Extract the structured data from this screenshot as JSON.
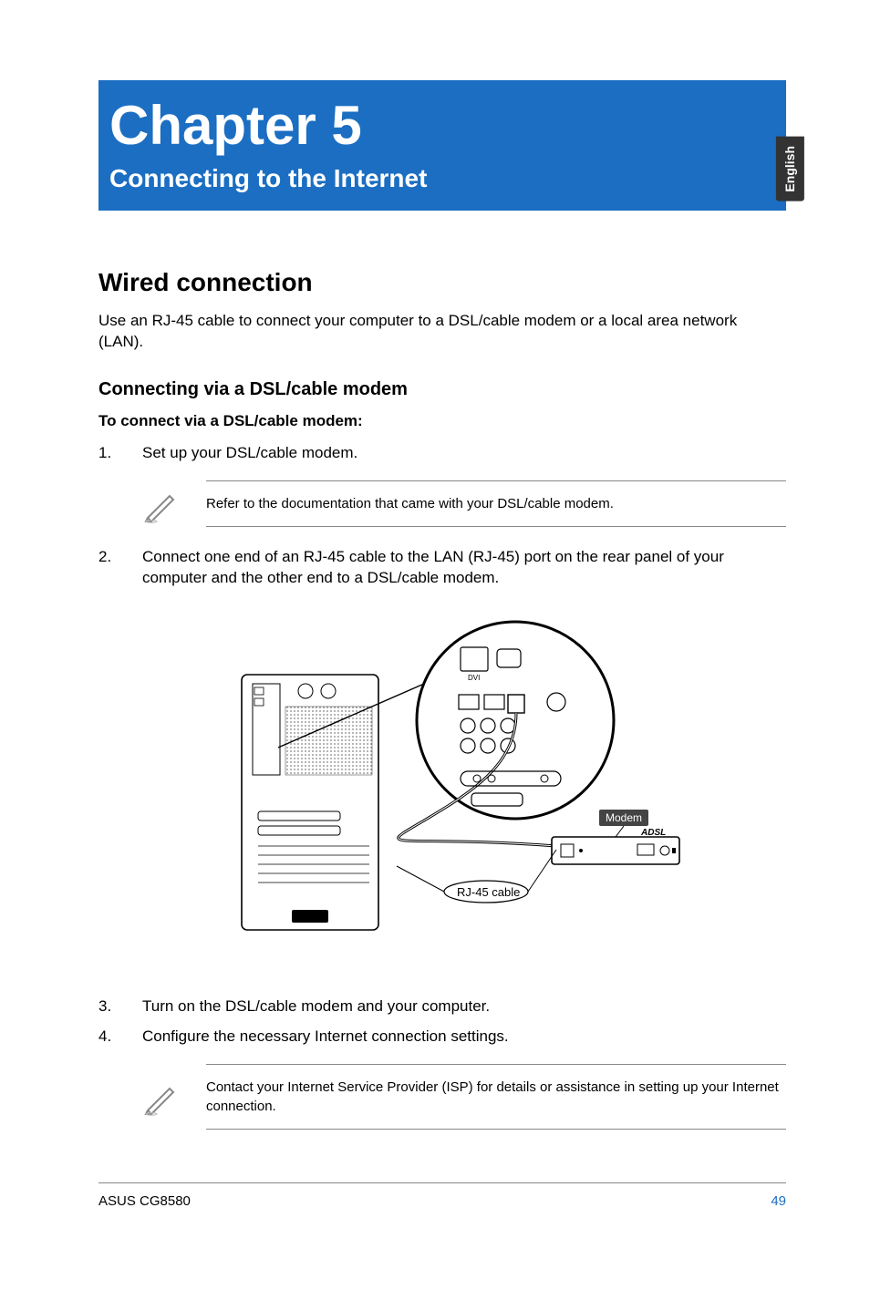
{
  "sideTab": "English",
  "chapter": {
    "title": "Chapter 5",
    "subtitle": "Connecting to the Internet"
  },
  "section": {
    "heading": "Wired connection",
    "intro": "Use an RJ-45 cable to connect your computer to a DSL/cable modem or a local area network (LAN).",
    "subsection": "Connecting via a DSL/cable modem",
    "boldLead": "To connect via a DSL/cable modem:"
  },
  "steps": {
    "s1": {
      "num": "1.",
      "text": "Set up your DSL/cable modem."
    },
    "note1": "Refer to the documentation that came with your DSL/cable modem.",
    "s2": {
      "num": "2.",
      "text": "Connect one end of an RJ-45 cable to the LAN (RJ-45) port on the rear panel of your computer and the other end to a DSL/cable modem."
    },
    "diagram": {
      "modemLabel": "Modem",
      "cableLabel": "RJ-45 cable",
      "modemBadge": "ADSL",
      "portDvi": "DVI"
    },
    "s3": {
      "num": "3.",
      "text": "Turn on the DSL/cable modem and your computer."
    },
    "s4": {
      "num": "4.",
      "text": "Configure the necessary Internet connection settings."
    },
    "note2": "Contact your Internet Service Provider (ISP) for details or assistance in setting up your Internet connection."
  },
  "footer": {
    "left": "ASUS CG8580",
    "right": "49"
  }
}
